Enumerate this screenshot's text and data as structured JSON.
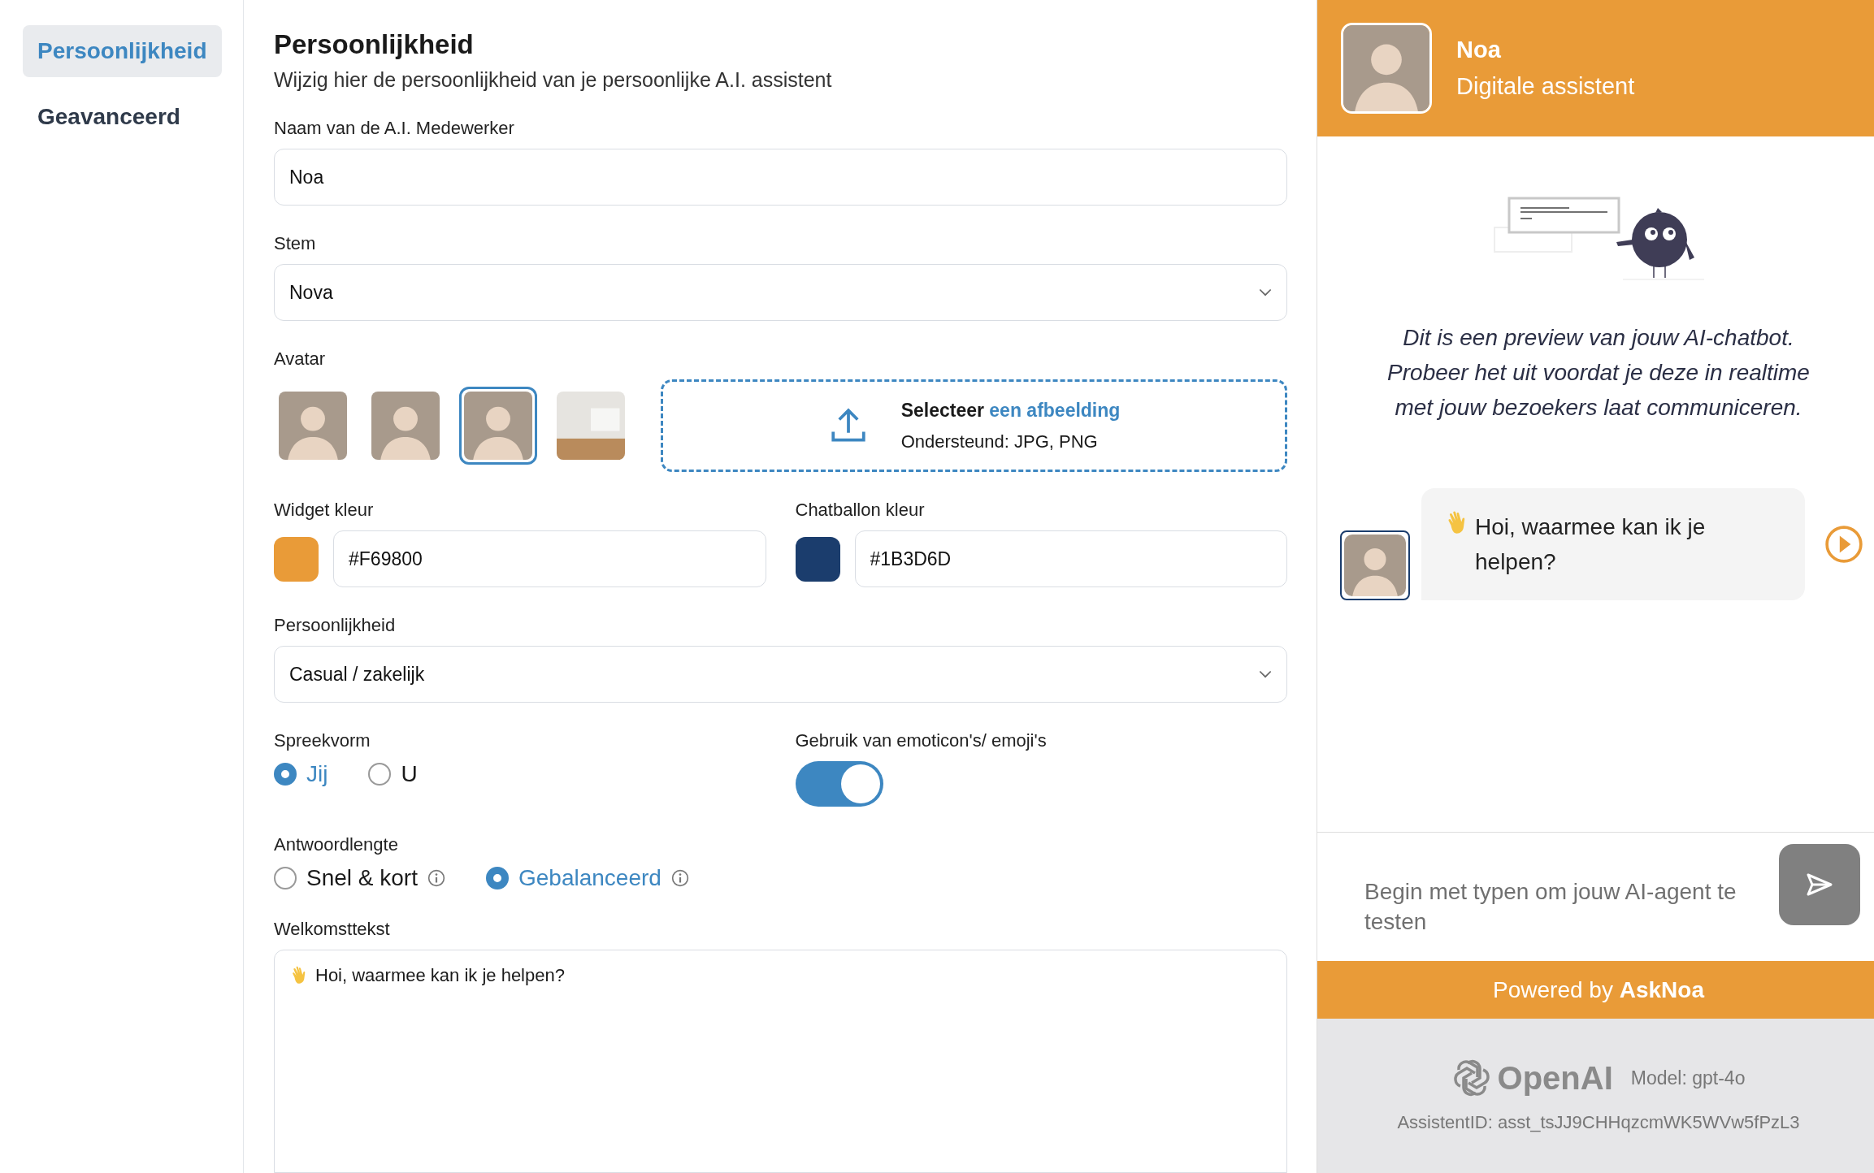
{
  "sidebar": {
    "items": [
      {
        "label": "Persoonlijkheid",
        "selected": true
      },
      {
        "label": "Geavanceerd",
        "selected": false
      }
    ]
  },
  "form": {
    "title": "Persoonlijkheid",
    "subtitle": "Wijzig hier de persoonlijkheid van je persoonlijke A.I. assistent",
    "name_field": {
      "label": "Naam van de A.I. Medewerker",
      "value": "Noa"
    },
    "voice_field": {
      "label": "Stem",
      "value": "Nova"
    },
    "avatar": {
      "label": "Avatar",
      "options": [
        {
          "kind": "person",
          "selected": false
        },
        {
          "kind": "person",
          "selected": false
        },
        {
          "kind": "person",
          "selected": true
        },
        {
          "kind": "interior",
          "selected": false
        }
      ],
      "upload": {
        "prompt": "Selecteer",
        "link": "een afbeelding",
        "hint": "Ondersteund: JPG, PNG"
      }
    },
    "widget_color": {
      "label": "Widget kleur",
      "value": "#F69800",
      "color": "#e99b38"
    },
    "bubble_color": {
      "label": "Chatballon kleur",
      "value": "#1B3D6D",
      "color": "#1b3d6d"
    },
    "personality_field": {
      "label": "Persoonlijkheid",
      "value": "Casual / zakelijk"
    },
    "speech_form": {
      "label": "Spreekvorm",
      "options": [
        {
          "label": "Jij",
          "selected": true
        },
        {
          "label": "U",
          "selected": false
        }
      ]
    },
    "emoji_toggle": {
      "label": "Gebruik van emoticon's/ emoji's",
      "on": true
    },
    "answer_length": {
      "label": "Antwoordlengte",
      "options": [
        {
          "label": "Snel & kort",
          "selected": false
        },
        {
          "label": "Gebalanceerd",
          "selected": true
        }
      ]
    },
    "welcome": {
      "label": "Welkomsttekst",
      "value": "Hoi, waarmee kan ik je helpen?"
    }
  },
  "preview": {
    "name": "Noa",
    "role": "Digitale assistent",
    "intro": "Dit is een preview van jouw AI-chatbot. Probeer het uit voordat je deze in realtime met jouw bezoekers laat communiceren.",
    "message": "Hoi, waarmee kan ik je helpen?",
    "input_placeholder": "Begin met typen om jouw AI-agent te testen",
    "powered": "Powered by **AskNoa**",
    "provider": "OpenAI",
    "model": "Model: gpt-4o",
    "assistant_id": "AssistentID: asst_tsJJ9CHHqzcmWK5WVw5fPzL3"
  }
}
